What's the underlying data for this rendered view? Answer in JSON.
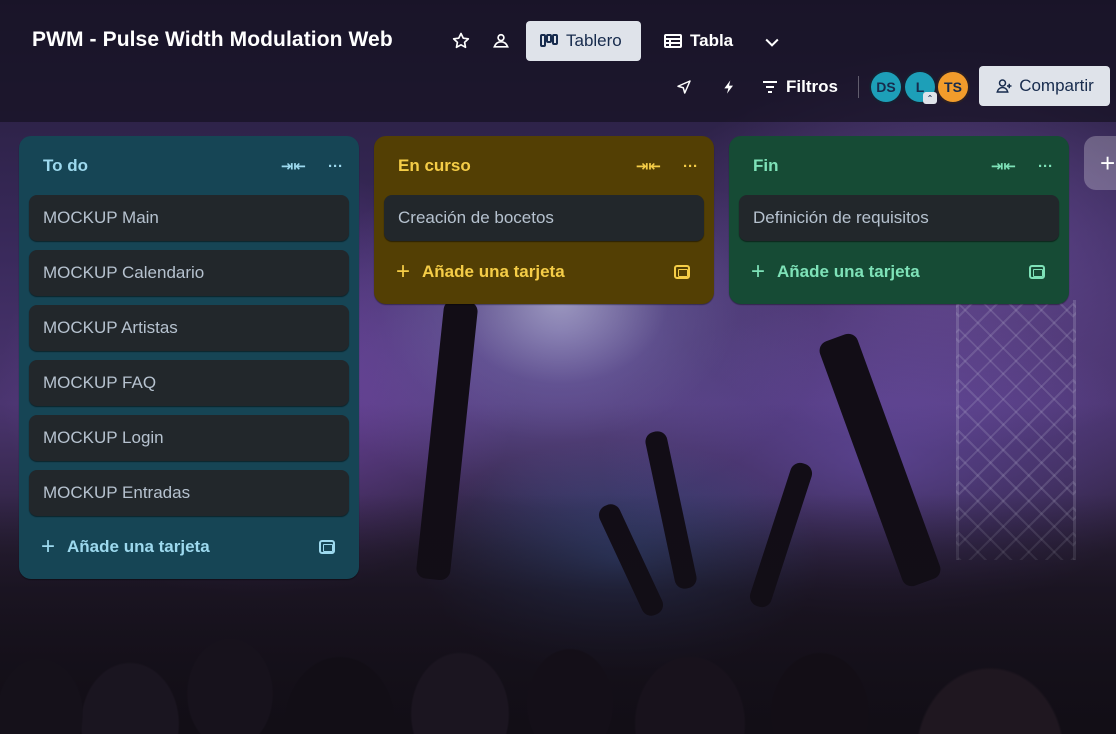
{
  "board": {
    "title": "PWM - Pulse Width Modulation Web",
    "star_icon": "star-icon",
    "visibility_icon": "team-visibility-icon"
  },
  "views": [
    {
      "label": "Tablero",
      "icon": "board-icon",
      "active": true
    },
    {
      "label": "Tabla",
      "icon": "table-icon",
      "active": false
    }
  ],
  "toolbar": {
    "filters_label": "Filtros",
    "share_label": "Compartir"
  },
  "members": [
    {
      "initials": "DS",
      "color": "#1d9fb8"
    },
    {
      "initials": "L",
      "color": "#1d9fb8"
    },
    {
      "initials": "TS",
      "color": "#f29c2b"
    }
  ],
  "lists": [
    {
      "title": "To do",
      "color": "#164555",
      "cards": [
        "MOCKUP Main",
        "MOCKUP Calendario",
        "MOCKUP Artistas",
        "MOCKUP FAQ",
        "MOCKUP Login",
        "MOCKUP Entradas"
      ],
      "add_label": "Añade una tarjeta"
    },
    {
      "title": "En curso",
      "color": "#533f04",
      "cards": [
        "Creación de bocetos"
      ],
      "add_label": "Añade una tarjeta"
    },
    {
      "title": "Fin",
      "color": "#164b35",
      "cards": [
        "Definición de requisitos"
      ],
      "add_label": "Añade una tarjeta"
    }
  ]
}
